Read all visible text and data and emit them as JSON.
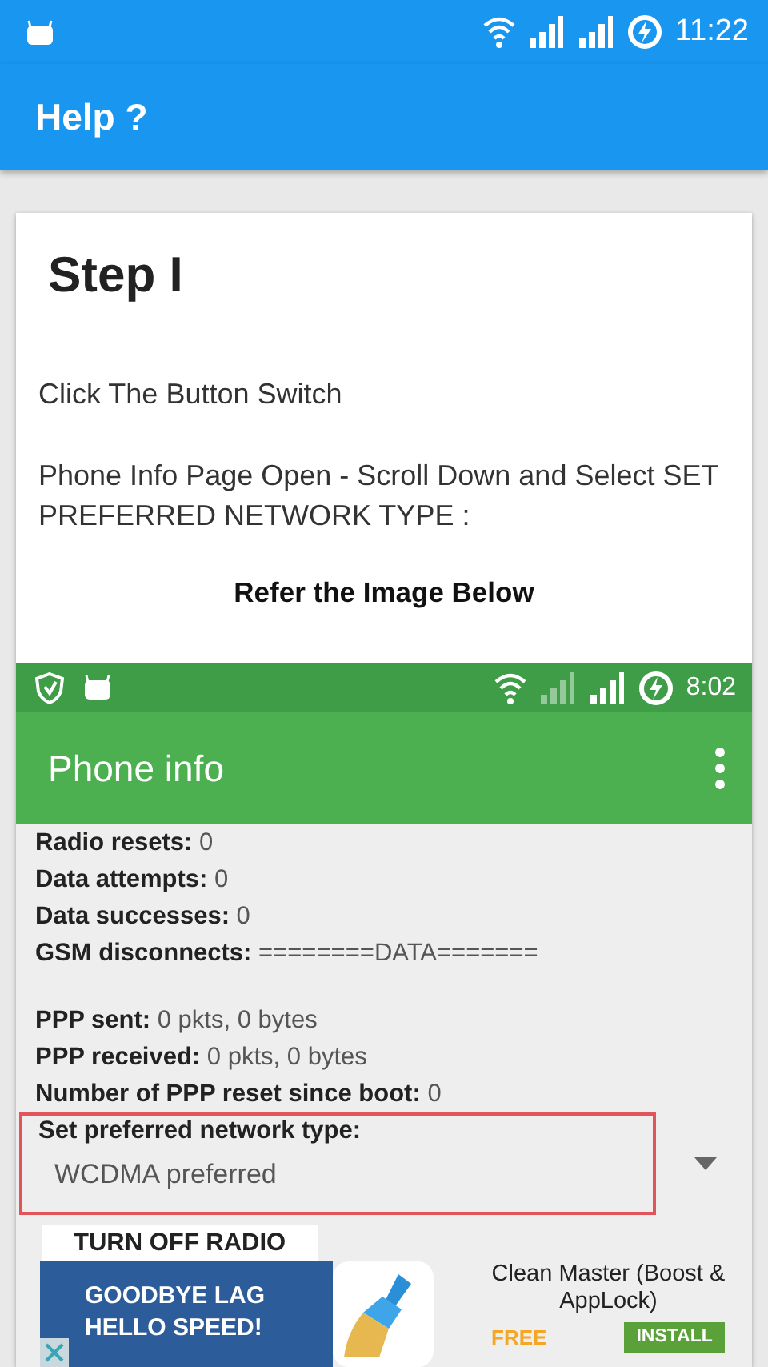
{
  "status_bar": {
    "time": "11:22"
  },
  "app_bar": {
    "title": "Help ?"
  },
  "card": {
    "heading": "Step I",
    "paragraphs": [
      "Click The Button Switch",
      "Phone Info Page Open - Scroll Down and Select  SET PREFERRED NETWORK TYPE :"
    ],
    "caption": "Refer the Image Below",
    "screenshot": {
      "status_bar": {
        "time": "8:02"
      },
      "app_bar": {
        "title": "Phone info"
      },
      "info_groups": [
        [
          {
            "label": "Radio resets:",
            "value": "0"
          },
          {
            "label": "Data attempts:",
            "value": "0"
          },
          {
            "label": "Data successes:",
            "value": "0"
          },
          {
            "label": "GSM disconnects:",
            "value": "========DATA======="
          }
        ],
        [
          {
            "label": "PPP sent:",
            "value": "0 pkts, 0 bytes"
          },
          {
            "label": "PPP received:",
            "value": "0 pkts, 0 bytes"
          },
          {
            "label": "Number of PPP reset since boot:",
            "value": "0"
          }
        ]
      ],
      "spinner": {
        "label": "Set preferred network type:",
        "value": "WCDMA preferred",
        "highlighted": true
      },
      "button": "TURN OFF RADIO"
    }
  },
  "ad": {
    "banner_lines": [
      "GOODBYE LAG",
      "HELLO SPEED!"
    ],
    "app_name": "Clean Master (Boost & AppLock)",
    "price": "FREE",
    "install": "INSTALL"
  }
}
